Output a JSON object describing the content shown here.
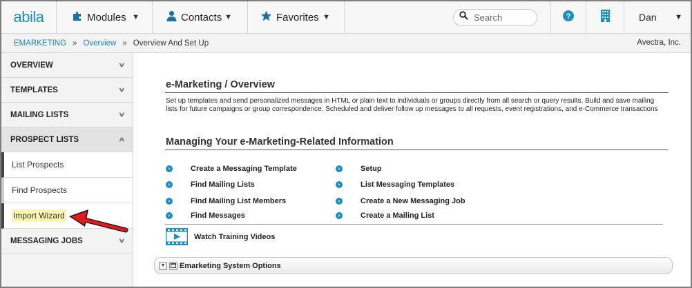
{
  "brand": {
    "logo": "abila"
  },
  "topnav": {
    "modules_label": "Modules",
    "contacts_label": "Contacts",
    "favorites_label": "Favorites",
    "search_placeholder": "Search",
    "user_label": "Dan",
    "icons": [
      "puzzle-icon",
      "person-icon",
      "star-icon",
      "search-icon",
      "help-icon",
      "building-icon",
      "caret-down-icon"
    ]
  },
  "breadcrumb": {
    "items": [
      "EMARKETING",
      "Overview",
      "Overview And Set Up"
    ],
    "separator": "»",
    "company": "Avectra, Inc."
  },
  "sidebar": {
    "overview": "OVERVIEW",
    "templates": "TEMPLATES",
    "mailing_lists": "MAILING LISTS",
    "prospect_lists": "PROSPECT LISTS",
    "prospect_items": [
      "List Prospects",
      "Find Prospects",
      "Import Wizard"
    ],
    "messaging_jobs": "MESSAGING JOBS"
  },
  "main": {
    "title": "e-Marketing / Overview",
    "intro": "Set up templates and send personalized messages in HTML or plain text to individuals or groups directly from all search or query results. Build and save mailing lists for future campaigns or group correspondence. Scheduled and deliver follow up messages to all requests, event registrations, and e-Commerce transactions",
    "section_title": "Managing Your e-Marketing-Related Information",
    "links_left": [
      "Create a Messaging Template",
      "Find Mailing Lists",
      "Find Mailing List Members",
      "Find Messages"
    ],
    "links_right": [
      "Setup",
      "List Messaging Templates",
      "Create a New Messaging Job",
      "Create a Mailing List"
    ],
    "video_label": "Watch Training Videos",
    "options_label": "Emarketing System Options"
  },
  "colors": {
    "accent": "#1a8fbf",
    "highlight": "#fbf7b0",
    "arrow": "#e01b1b"
  }
}
